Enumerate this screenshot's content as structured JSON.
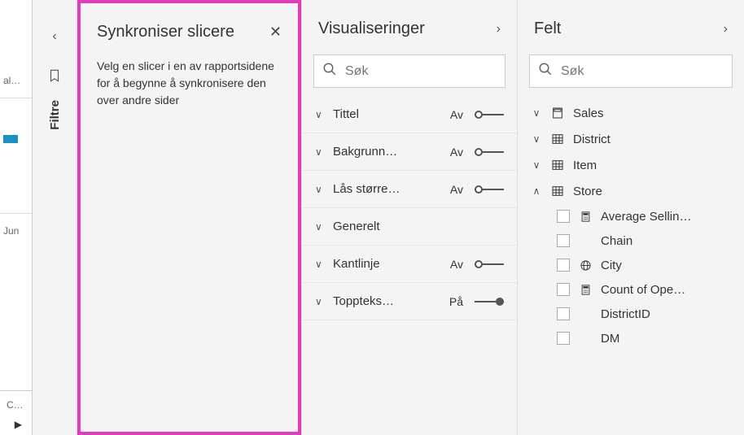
{
  "stub": {
    "top_label": "al…",
    "mid_label": "Jun",
    "bottom_label": "Ca…"
  },
  "filters": {
    "label": "Filtre"
  },
  "sync": {
    "title": "Synkroniser slicere",
    "body": "Velg en slicer i en av rapportsidene for å begynne å synkronisere den over andre sider"
  },
  "viz": {
    "title": "Visualiseringer",
    "search_placeholder": "Søk",
    "rows": [
      {
        "label": "Tittel",
        "state": "Av",
        "on": false
      },
      {
        "label": "Bakgrunn…",
        "state": "Av",
        "on": false
      },
      {
        "label": "Lås større…",
        "state": "Av",
        "on": false
      },
      {
        "label": "Generelt",
        "state": "",
        "on": null
      },
      {
        "label": "Kantlinje",
        "state": "Av",
        "on": false
      },
      {
        "label": "Toppteks…",
        "state": "På",
        "on": true
      }
    ]
  },
  "fields": {
    "title": "Felt",
    "search_placeholder": "Søk",
    "tables": [
      {
        "name": "Sales",
        "expanded": false,
        "icon": "calc-table"
      },
      {
        "name": "District",
        "expanded": false,
        "icon": "table"
      },
      {
        "name": "Item",
        "expanded": false,
        "icon": "table"
      },
      {
        "name": "Store",
        "expanded": true,
        "icon": "table",
        "children": [
          {
            "name": "Average Sellin…",
            "icon": "calc"
          },
          {
            "name": "Chain",
            "icon": ""
          },
          {
            "name": "City",
            "icon": "globe"
          },
          {
            "name": "Count of Ope…",
            "icon": "calc"
          },
          {
            "name": "DistrictID",
            "icon": ""
          },
          {
            "name": "DM",
            "icon": ""
          }
        ]
      }
    ]
  }
}
